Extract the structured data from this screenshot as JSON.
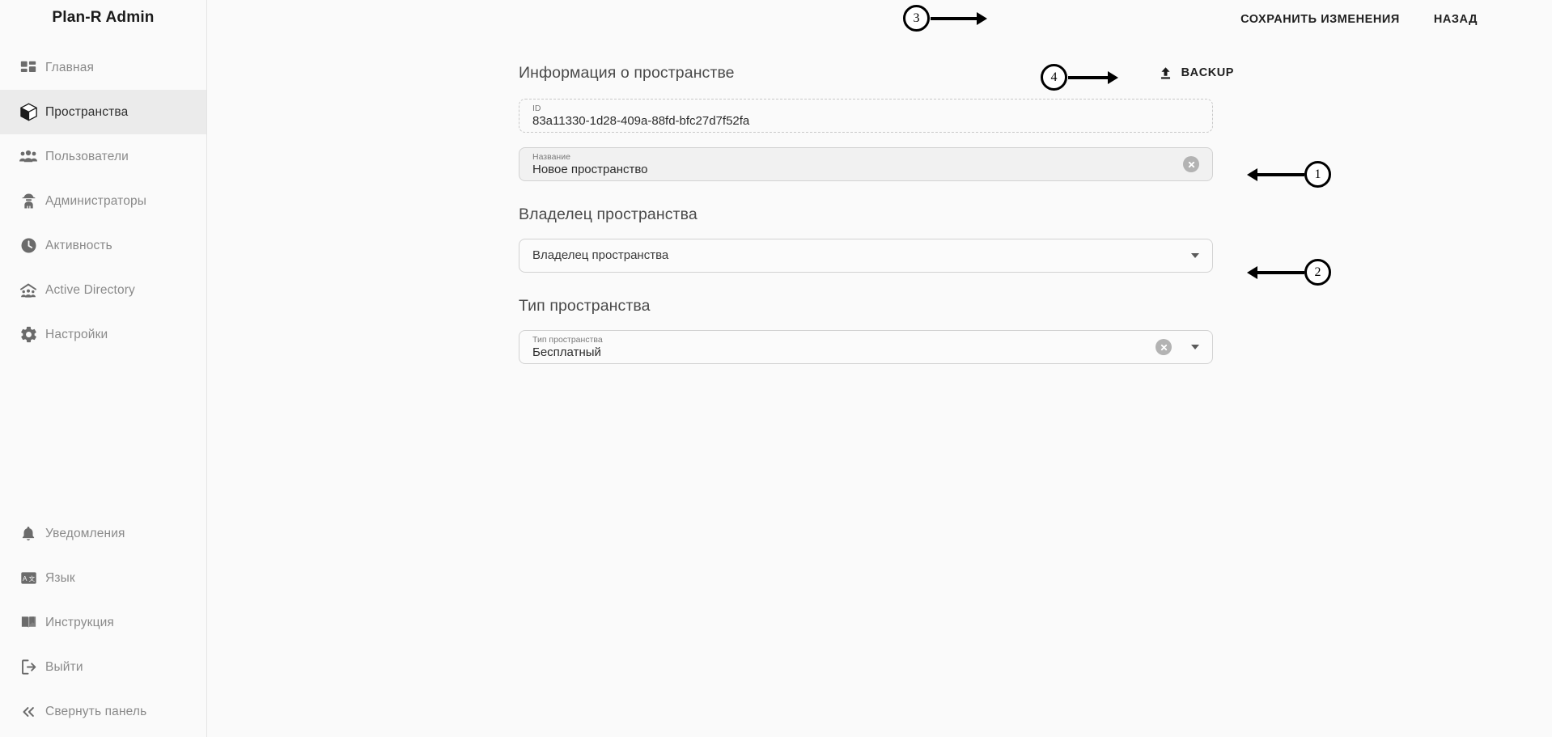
{
  "sidebar": {
    "brand": "Plan-R Admin",
    "top_items": [
      {
        "label": "Главная",
        "icon": "dashboard-grid-icon",
        "active": false
      },
      {
        "label": "Пространства",
        "icon": "cube-icon",
        "active": true
      },
      {
        "label": "Пользователи",
        "icon": "people-group-icon",
        "active": false
      },
      {
        "label": "Администраторы",
        "icon": "detective-icon",
        "active": false
      },
      {
        "label": "Активность",
        "icon": "clock-icon",
        "active": false
      },
      {
        "label": "Active Directory",
        "icon": "directory-house-icon",
        "active": false
      },
      {
        "label": "Настройки",
        "icon": "gear-icon",
        "active": false
      }
    ],
    "bottom_items": [
      {
        "label": "Уведомления",
        "icon": "bell-icon"
      },
      {
        "label": "Язык",
        "icon": "translate-icon"
      },
      {
        "label": "Инструкция",
        "icon": "book-icon"
      },
      {
        "label": "Выйти",
        "icon": "logout-icon"
      },
      {
        "label": "Свернуть панель",
        "icon": "chevron-double-left-icon"
      }
    ]
  },
  "topbar": {
    "save_label": "СОХРАНИТЬ ИЗМЕНЕНИЯ",
    "back_label": "НАЗАД"
  },
  "form": {
    "info_heading": "Информация о пространстве",
    "backup_label": "BACKUP",
    "id_field": {
      "label": "ID",
      "value": "83a11330-1d28-409a-88fd-bfc27d7f52fa"
    },
    "name_field": {
      "label": "Название",
      "value": "Новое пространство"
    },
    "owner_heading": "Владелец пространства",
    "owner_field": {
      "placeholder": "Владелец пространства",
      "value": ""
    },
    "type_heading": "Тип пространства",
    "type_field": {
      "label": "Тип пространства",
      "value": "Бесплатный"
    }
  },
  "annotations": [
    {
      "number": "1"
    },
    {
      "number": "2"
    },
    {
      "number": "3"
    },
    {
      "number": "4"
    }
  ],
  "colors": {
    "page_bg": "#fafafa",
    "active_item_bg": "#ebebeb",
    "text_primary": "#2e2e2e",
    "text_muted": "#8a8a8a",
    "border": "#d2d2d2"
  }
}
